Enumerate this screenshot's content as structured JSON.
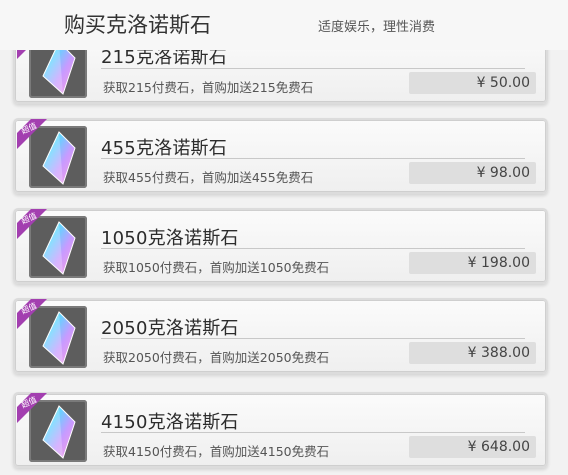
{
  "header": {
    "title": "购买克洛诺斯石",
    "slogan": "适度娱乐，理性消费"
  },
  "colors": {
    "badge": "#a33fb0",
    "price_bg": "#dedede",
    "card_border": "#dcdcdc"
  },
  "items": [
    {
      "name": "215克洛诺斯石",
      "desc": "获取215付费石，首购加送215免费石",
      "price": "¥  50.00",
      "badge": "超值",
      "icon": "crystal-icon"
    },
    {
      "name": "455克洛诺斯石",
      "desc": "获取455付费石，首购加送455免费石",
      "price": "¥  98.00",
      "badge": "超值",
      "icon": "crystal-icon"
    },
    {
      "name": "1050克洛诺斯石",
      "desc": "获取1050付费石，首购加送1050免费石",
      "price": "¥  198.00",
      "badge": "超值",
      "icon": "crystal-icon"
    },
    {
      "name": "2050克洛诺斯石",
      "desc": "获取2050付费石，首购加送2050免费石",
      "price": "¥  388.00",
      "badge": "超值",
      "icon": "crystal-icon"
    },
    {
      "name": "4150克洛诺斯石",
      "desc": "获取4150付费石，首购加送4150免费石",
      "price": "¥  648.00",
      "badge": "超值",
      "icon": "crystal-icon"
    }
  ]
}
